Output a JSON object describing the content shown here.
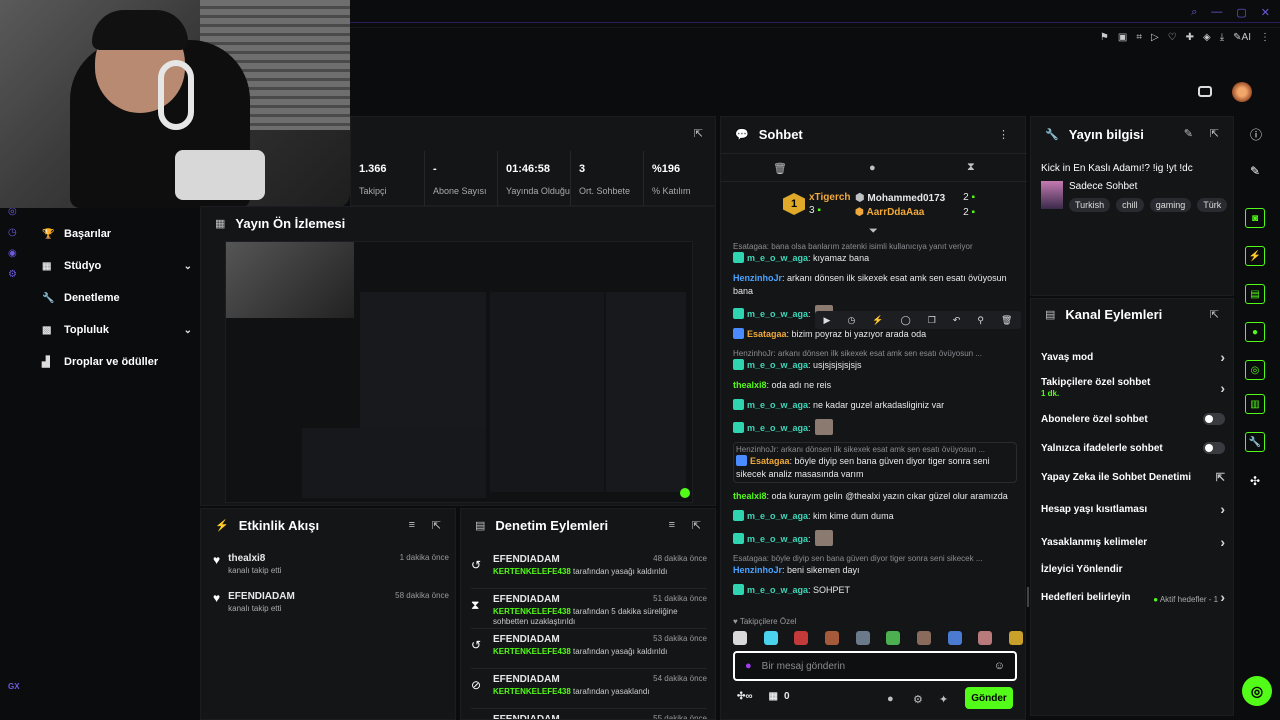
{
  "stats": [
    {
      "value": "1.366",
      "label": "Takipçi"
    },
    {
      "value": "-",
      "label": "Abone Sayısı"
    },
    {
      "value": "01:46:58",
      "label": "Yayında Olduğu"
    },
    {
      "value": "3",
      "label": "Ort. Sohbete"
    },
    {
      "value": "%196",
      "label": "% Katılım"
    }
  ],
  "nav": [
    {
      "label": "Başarılar",
      "icon": "trophy-icon"
    },
    {
      "label": "Stüdyo",
      "icon": "studio-icon",
      "chevron": true
    },
    {
      "label": "Denetleme",
      "icon": "wrench-icon"
    },
    {
      "label": "Topluluk",
      "icon": "community-icon",
      "chevron": true
    },
    {
      "label": "Droplar ve ödüller",
      "icon": "drops-icon"
    }
  ],
  "preview_title": "Yayın Ön İzlemesi",
  "activity": {
    "title": "Etkinlik Akışı",
    "items": [
      {
        "user": "thealxi8",
        "action": "kanalı takip etti",
        "time": "1 dakika önce"
      },
      {
        "user": "EFENDIADAM",
        "action": "kanalı takip etti",
        "time": "58 dakika önce"
      }
    ]
  },
  "moderation": {
    "title": "Denetim Eylemleri",
    "items": [
      {
        "user": "EFENDIADAM",
        "time": "48 dakika önce",
        "by": "KERTENKELEFE438",
        "text": "tarafından yasağı kaldırıldı",
        "icon": "undo-icon"
      },
      {
        "user": "EFENDIADAM",
        "time": "51 dakika önce",
        "by": "KERTENKELEFE438",
        "text": "tarafından 5 dakika süreliğine sohbetten uzaklaştırıldı",
        "icon": "hourglass-icon"
      },
      {
        "user": "EFENDIADAM",
        "time": "53 dakika önce",
        "by": "KERTENKELEFE438",
        "text": "tarafından yasağı kaldırıldı",
        "icon": "undo-icon"
      },
      {
        "user": "EFENDIADAM",
        "time": "54 dakika önce",
        "by": "KERTENKELEFE438",
        "text": "tarafından yasaklandı",
        "icon": "ban-icon"
      },
      {
        "user": "EFENDIADAM",
        "time": "55 dakika önce",
        "by": "",
        "text": "",
        "icon": "undo-icon"
      }
    ]
  },
  "chat": {
    "title": "Sohbet",
    "leaderboard": [
      {
        "rank": "1",
        "name": "xTigerch",
        "count": "3"
      },
      {
        "name": "Mohammed0173",
        "count": "2"
      },
      {
        "name": "AarrDdaAaa",
        "count": "2"
      }
    ],
    "messages": [
      {
        "reply": "Esatagaa: bana olsa banlarım zatenki isimli kullanıcıya yanıt veriyor",
        "user": "m_e_o_w_aga",
        "cls": "u1",
        "text": ": kıyamaz bana"
      },
      {
        "user": "HenzinhoJr",
        "cls": "u3",
        "text": ": arkanı dönsen ilk sikexek esat amk sen esatı övüyosun bana"
      },
      {
        "user": "m_e_o_w_aga",
        "cls": "u1",
        "text": ":"
      },
      {
        "user": "Esatagaa",
        "cls": "u4",
        "text": ": bizim poyraz bi yazıyor arada oda"
      },
      {
        "reply": "HenzinhoJr: arkanı dönsen ilk sikexek esat amk sen esatı övüyosun ...",
        "user": "m_e_o_w_aga",
        "cls": "u1",
        "text": ": usjsjsjsjsjsjs"
      },
      {
        "user": "thealxi8",
        "cls": "u2",
        "text": ": oda adı ne reis"
      },
      {
        "user": "m_e_o_w_aga",
        "cls": "u1",
        "text": ": ne kadar guzel arkadasliginiz var"
      },
      {
        "user": "m_e_o_w_aga",
        "cls": "u1",
        "text": ":"
      },
      {
        "reply": "HenzinhoJr: arkanı dönsen ilk sikexek esat amk sen esatı övüyosun ...",
        "user": "Esatagaa",
        "cls": "u4",
        "text": ": böyle diyip sen bana güven diyor tiger sonra seni sikecek analiz masasında varım"
      },
      {
        "user": "thealxi8",
        "cls": "u2",
        "text": ": oda kurayım gelin @thealxi yazın cıkar güzel olur aramızda"
      },
      {
        "user": "m_e_o_w_aga",
        "cls": "u1",
        "text": ": kim kime dum duma"
      },
      {
        "user": "m_e_o_w_aga",
        "cls": "u1",
        "text": ":"
      },
      {
        "reply": "Esatagaa: böyle diyip sen bana güven diyor tiger sonra seni sikecek ...",
        "user": "HenzinhoJr",
        "cls": "u3",
        "text": ": beni sikemen dayı"
      },
      {
        "user": "m_e_o_w_aga",
        "cls": "u1",
        "text": ": SOHPET"
      }
    ],
    "followers_only": "Takipçilere Özel",
    "placeholder": "Bir mesaj gönderin",
    "points": "0",
    "send": "Gönder"
  },
  "stream_info": {
    "title": "Yayın bilgisi",
    "stream_title": "Kick in En Kaslı Adamı!? !ig !yt !dc",
    "category": "Sadece Sohbet",
    "tags": [
      "Turkish",
      "chill",
      "gaming",
      "Türk"
    ]
  },
  "channel_actions": {
    "title": "Kanal Eylemleri",
    "slow": "Yavaş mod",
    "followers_chat": "Takipçilere özel sohbet",
    "followers_chat_sub": "1 dk.",
    "subs": "Abonelere özel sohbet",
    "emotes": "Yalnızca ifadelerle sohbet",
    "ai": "Yapay Zeka ile Sohbet Denetimi",
    "age": "Hesap yaşı kısıtlaması",
    "banned": "Yasaklanmış kelimeler",
    "redirect": "İzleyici Yönlendir",
    "goals": "Hedefleri belirleyin",
    "goals_sub": "Aktif hedefler - 1"
  },
  "footer_tag": "GX"
}
